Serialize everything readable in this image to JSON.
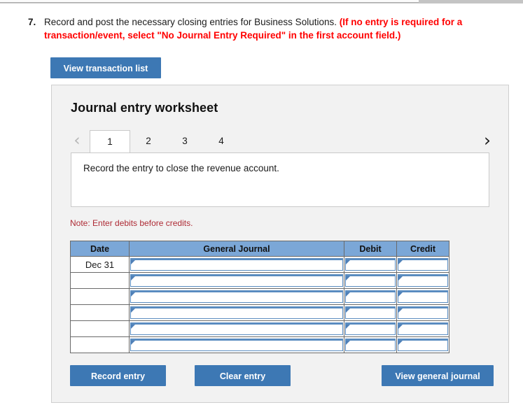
{
  "browser": {
    "chrome_visible": true
  },
  "question": {
    "number": "7.",
    "text": "Record and post the necessary closing entries for Business Solutions.",
    "hint": "(If no entry is required for a transaction/event, select \"No Journal Entry Required\" in the first account field.)"
  },
  "toolbar": {
    "view_transaction_list_label": "View transaction list"
  },
  "worksheet": {
    "title": "Journal entry worksheet",
    "prev_icon": "chevron-left-icon",
    "next_icon": "chevron-right-icon",
    "tabs": [
      {
        "label": "1",
        "active": true
      },
      {
        "label": "2",
        "active": false
      },
      {
        "label": "3",
        "active": false
      },
      {
        "label": "4",
        "active": false
      }
    ],
    "instruction": "Record the entry to close the revenue account.",
    "note": "Note: Enter debits before credits."
  },
  "journal_table": {
    "columns": [
      "Date",
      "General Journal",
      "Debit",
      "Credit"
    ],
    "rows": [
      {
        "date": "Dec 31",
        "general_journal": "",
        "debit": "",
        "credit": ""
      },
      {
        "date": "",
        "general_journal": "",
        "debit": "",
        "credit": ""
      },
      {
        "date": "",
        "general_journal": "",
        "debit": "",
        "credit": ""
      },
      {
        "date": "",
        "general_journal": "",
        "debit": "",
        "credit": ""
      },
      {
        "date": "",
        "general_journal": "",
        "debit": "",
        "credit": ""
      },
      {
        "date": "",
        "general_journal": "",
        "debit": "",
        "credit": ""
      }
    ]
  },
  "actions": {
    "record_entry_label": "Record entry",
    "clear_entry_label": "Clear entry",
    "view_general_journal_label": "View general journal"
  },
  "colors": {
    "primary_blue": "#3d78b4",
    "table_header_blue": "#7ba7d7",
    "field_border_blue": "#5a8cc0",
    "hint_red": "#ff0000",
    "note_red": "#ae2b35",
    "panel_bg": "#f2f2f2"
  }
}
